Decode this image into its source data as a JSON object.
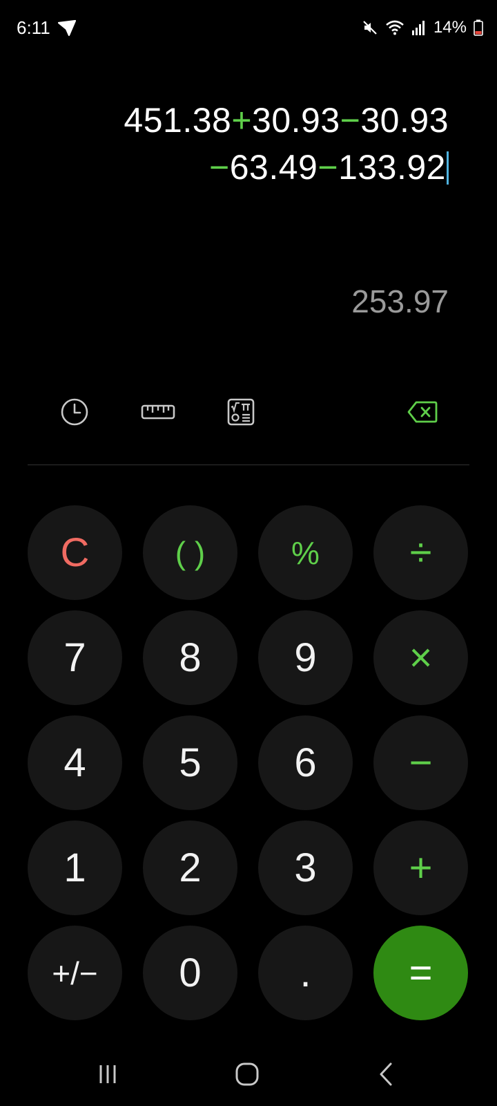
{
  "status_bar": {
    "time": "6:11",
    "battery": "14%",
    "icons": [
      "send-icon",
      "mute-icon",
      "wifi-icon",
      "signal-icon",
      "battery-icon"
    ]
  },
  "display": {
    "expression_line1": [
      "451.38",
      "+",
      "30.93",
      "−",
      "30.93"
    ],
    "expression_line2": [
      "−",
      "63.49",
      "−",
      "133.92"
    ],
    "result": "253.97"
  },
  "toolbar": {
    "icons": [
      "history-icon",
      "ruler-icon",
      "scientific-icon",
      "backspace-icon"
    ]
  },
  "keypad": {
    "clear": "C",
    "parentheses": "( )",
    "percent": "%",
    "divide": "÷",
    "seven": "7",
    "eight": "8",
    "nine": "9",
    "multiply": "×",
    "four": "4",
    "five": "5",
    "six": "6",
    "minus": "−",
    "one": "1",
    "two": "2",
    "three": "3",
    "plus": "+",
    "negate": "+/−",
    "zero": "0",
    "decimal": ".",
    "equals": "="
  },
  "colors": {
    "accent": "#5fcf4a",
    "clear": "#f06b62",
    "equals_bg": "#2f8a13",
    "key_bg": "#171717",
    "result_text": "#9a9a9a",
    "cursor": "#4fb3e0"
  },
  "nav_bar": {
    "icons": [
      "recents-icon",
      "home-icon",
      "back-icon"
    ]
  }
}
